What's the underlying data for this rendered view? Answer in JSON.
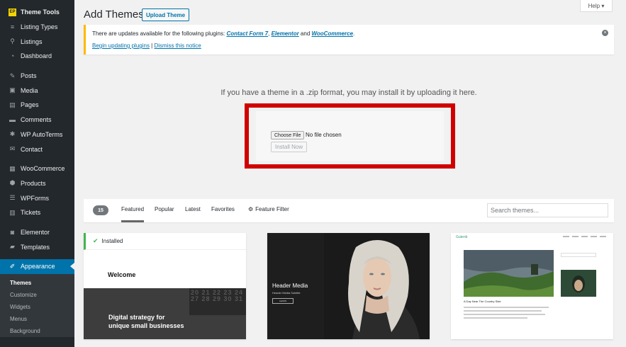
{
  "sidebar": {
    "logo_text": "EP",
    "items": [
      {
        "label": "Theme Tools",
        "icon": "theme-tools-logo"
      },
      {
        "label": "Listing Types",
        "icon": "list-icon"
      },
      {
        "label": "Listings",
        "icon": "location-pin-icon"
      },
      {
        "label": "Dashboard",
        "icon": "dashboard-icon"
      },
      {
        "label": "Posts",
        "icon": "pin-icon"
      },
      {
        "label": "Media",
        "icon": "media-icon"
      },
      {
        "label": "Pages",
        "icon": "pages-icon"
      },
      {
        "label": "Comments",
        "icon": "comment-icon"
      },
      {
        "label": "WP AutoTerms",
        "icon": "gear-icon"
      },
      {
        "label": "Contact",
        "icon": "mail-icon"
      },
      {
        "label": "WooCommerce",
        "icon": "woo-icon"
      },
      {
        "label": "Products",
        "icon": "cube-icon"
      },
      {
        "label": "WPForms",
        "icon": "form-icon"
      },
      {
        "label": "Tickets",
        "icon": "ticket-icon"
      },
      {
        "label": "Elementor",
        "icon": "elementor-icon"
      },
      {
        "label": "Templates",
        "icon": "folder-icon"
      },
      {
        "label": "Appearance",
        "icon": "brush-icon"
      }
    ],
    "submenu": [
      "Themes",
      "Customize",
      "Widgets",
      "Menus",
      "Background"
    ]
  },
  "header": {
    "title": "Add Themes",
    "upload_button": "Upload Theme",
    "help": "Help ▾"
  },
  "notice": {
    "text_before": "There are updates available for the following plugins: ",
    "plugin1": "Contact Form 7",
    "sep1": ", ",
    "plugin2": "Elementor",
    "sep2": " and ",
    "plugin3": "WooCommerce",
    "end": ".",
    "begin_link": "Begin updating plugins",
    "divider": " | ",
    "dismiss_link": "Dismiss this notice",
    "close_glyph": "×"
  },
  "upload": {
    "instructions": "If you have a theme in a .zip format, you may install it by uploading it here.",
    "choose_file": "Choose File",
    "no_file": "No file chosen",
    "install_now": "Install Now"
  },
  "filter": {
    "count": "15",
    "tabs": [
      "Featured",
      "Popular",
      "Latest",
      "Favorites"
    ],
    "feature_filter": "Feature Filter",
    "search_placeholder": "Search themes..."
  },
  "themes": {
    "card1": {
      "installed": "Installed",
      "welcome": "Welcome",
      "tagline1": "Digital strategy for",
      "tagline2": "unique small businesses",
      "calendar": "20 21 22 23 24 27 28 29 30 31"
    },
    "card2": {
      "title": "Header Media",
      "subtitle": "Header Media Subtitle",
      "button": "LEARN"
    },
    "card3": {
      "site_name": "Gutenb",
      "post_title": "A Day Near The Country Side"
    }
  },
  "colors": {
    "sidebar_bg": "#23282d",
    "accent": "#0073aa",
    "highlight_border": "#d00000",
    "installed_green": "#46b450",
    "notice_warning": "#ffb900"
  }
}
